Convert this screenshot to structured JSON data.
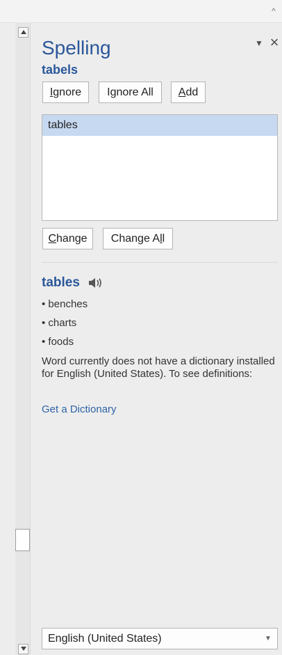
{
  "header": {
    "scroll_up_glyph": "^"
  },
  "spelling_pane": {
    "title": "Spelling",
    "misspelled_word": "tabels",
    "menu_icon": "chevron-down-icon",
    "close_icon": "close-icon"
  },
  "actions": {
    "ignore": {
      "accelerator": "I",
      "rest": "gnore"
    },
    "ignore_all": {
      "pre": "I",
      "accelerator": "g",
      "rest": "nore All"
    },
    "add": {
      "accelerator": "A",
      "rest": "dd"
    },
    "change": {
      "accelerator": "C",
      "rest": "hange"
    },
    "change_all": {
      "pre": "Change A",
      "accelerator": "l",
      "rest": "l"
    }
  },
  "suggestions": [
    {
      "label": "tables",
      "selected": true
    }
  ],
  "definition": {
    "word": "tables",
    "speaker_icon": "speaker-icon",
    "synonyms": [
      "• benches",
      "• charts",
      "• foods"
    ],
    "message": "Word currently does not have a dictionary installed for English (United States). To see definitions:",
    "link": "Get a Dictionary"
  },
  "language": {
    "selected": "English (United States)",
    "arrow_icon": "chevron-down-icon"
  },
  "colors": {
    "accent": "#2b579a",
    "link": "#2e63a8",
    "selected_row": "#c7d9f1",
    "panel_bg": "#ededed"
  }
}
